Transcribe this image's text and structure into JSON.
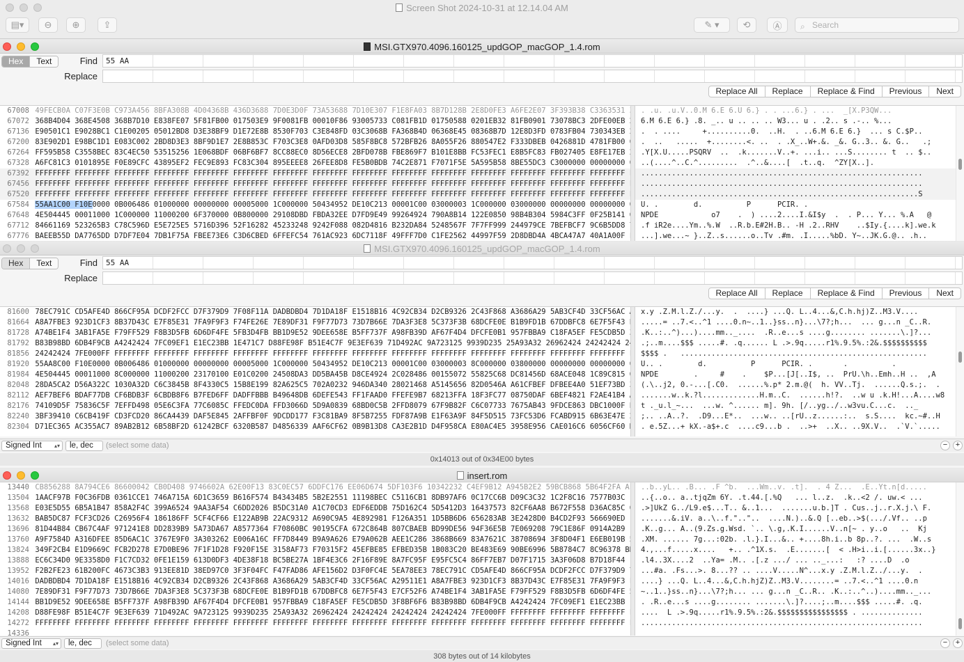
{
  "preview": {
    "title": "Screen Shot 2024-10-31 at 12.14.04 AM",
    "search_placeholder": "Search"
  },
  "win1": {
    "title": "MSI.GTX970.4096.160125_updGOP_macGOP_1.4.rom",
    "mode_hex": "Hex",
    "mode_text": "Text",
    "find_label": "Find",
    "find_value": "55 AA",
    "replace_label": "Replace",
    "buttons": [
      "Replace All",
      "Replace",
      "Replace & Find",
      "Previous",
      "Next"
    ],
    "hex_rows": [
      {
        "off": "67072",
        "hex": "368B4D04 368E4508 368B7D10 E838FE07 5F81FB00 017503E9 9F0081FB 00010F86 93005733 C081FB1D 01750588 0201EB32 81FB0901 73078BC3 2DFE00EB 258BCB81"
      },
      {
        "off": "67136",
        "hex": "E90501C1 E9028BC1 C1E00205 05012BD8 D3E38BF9 D1E72E8B 8530F703 C3E848FD 03C3068B FA368B4D 06368E45 08368B7D 12E8D3FD 0783FB04 730343EB 24508BCB"
      },
      {
        "off": "67200",
        "hex": "83E902D1 E98BC1D1 E083C002 2BD8D3E3 8BF9D1E7 2E8B853C F703C3E8 0AFD03D8 585F8BC8 572BFB26 8A055F26 880547E2 F333DBEB 0426881D 4781FB00 010F853B"
      },
      {
        "off": "67264",
        "hex": "FF595B58 C3558BEC 83C4EC50 53515256 1E068BDF 06BF6BF7 8CC88EC0 8D56ECE8 2BFD078B FBE869F7 B101E8BB FC53FEC1 E8B5FC83 FB027405 E8FE17EB 24B105E8"
      },
      {
        "off": "67328",
        "hex": "A6FC81C3 0101895E F0E89CFC 43895EF2 FEC9E893 FC83C304 895EEEE8 26FEE8D8 FE5B0BDB 74C2E871 F7071F5E 5A595B58 8BE55DC3 C3000000 00000000 00000000"
      },
      {
        "off": "67392",
        "hex": "FFFFFFFF FFFFFFFF FFFFFFFF FFFFFFFF FFFFFFFF FFFFFFFF FFFFFFFF FFFFFFFF FFFFFFFF FFFFFFFF FFFFFFFF FFFFFFFF FFFFFFFF FFFFFFFF FFFFFFFF FFFFFFFF"
      },
      {
        "off": "67456",
        "hex": "FFFFFFFF FFFFFFFF FFFFFFFF FFFFFFFF FFFFFFFF FFFFFFFF FFFFFFFF FFFFFFFF FFFFFFFF FFFFFFFF FFFFFFFF FFFFFFFF FFFFFFFF FFFFFFFF FFFFFFFF FFFFFFFF"
      },
      {
        "off": "67520",
        "hex": "FFFFFFFF FFFFFFFF FFFFFFFF FFFFFFFF FFFFFFFF FFFFFFFF FFFFFFFF FFFFFFFF FFFFFFFF FFFFFFFF FFFFFFFF FFFFFFFF FFFFFFFF FFFFFFFF FFFFFFFF FFFFFF53"
      },
      {
        "off": "67584",
        "hex_hl": "55AA1C00 F10E",
        "hex": "0000 0B006486 01000000 00000000 00005000 1C000000 50434952 DE10C213 00001C00 03000003 1C000000 03000000 00000000 00000000 00000000 00000000"
      },
      {
        "off": "67648",
        "hex": "4E504445 00011000 1C000000 11000200 6F370000 0B800000 29108DBD FBDA32EE D7FD9E49 99264924 790A8B14 122E0850 98B4B304 5984C3FF 0F25B141 00161040"
      },
      {
        "off": "67712",
        "hex": "84661169 523265B3 C78C596D E5E725E5 5716D396 52F16282 45233248 9242F088 082D4816 B232DA84 5248567F 7F7FF999 244979CE 7BEFBCF7 9C6B5DD8 7765DD6B"
      },
      {
        "off": "67776",
        "hex": "BAEEB55D DA7765DD D7DF7E04 7DB1F75A FBEE73E6 C3D6CBED 6FFEFC54 761AC923 6DC7118F 49FFF7D0 C1FE2562 44997F59 2D8DBD4A 4BCA47A7 40A1A00F F068D9D2"
      }
    ],
    "ascii_rows": [
      "6.M 6.E 6.} .8. _.. u .. .. .. W3... u . .2.. s .-.. %...",
      ".  . ....     +..........0.  ..H.  . ..6.M 6.E 6.}  ... s C.$P..",
      ".  ..   .....  +........<. ..  . .X_..W+.&. _&. G..3.. &. G..   .;",
      ".Y[X.U.....PSQRV  ..  .k.......V..+. ...i.. ...S........ t  .. $..",
      "..(....^..C.^.........  .^..&....[  .t..q.  ^ZY[X..].",
      "................................................................",
      "................................................................",
      "...............................................................S",
      "U. .        d.          P      PCIR. .",
      "NPDE            o7    .  ) ....2....I.&I$y  .  . P... Y... %.A   @",
      ".f iR2e....Ym..%.W  ..R.b.E#2H.B.. -H .2..RHV    ..$Iy.{....k].we.k",
      "...].we...~ }..Z..s......o..Tv .#m. .I.....%bD. Y~..JK.G.@.. .h.."
    ]
  },
  "win2": {
    "title": "MSI.GTX970.4096.160125_updGOP_macGOP_1.4.rom",
    "mode_hex": "Hex",
    "mode_text": "Text",
    "find_label": "Find",
    "find_value": "55 AA",
    "replace_label": "Replace",
    "buttons": [
      "Replace All",
      "Replace",
      "Replace & Find",
      "Previous",
      "Next"
    ],
    "hex_rows": [
      {
        "off": "81600",
        "hex": "78EC791C CD5AFE4D 866CF95A DCDF2FCC D7F379D9 7F08F11A DADBDBD4 7D1DA18F E1518B16 4C92CB34 D2CB9326 2C43F868 A3686A29 5AB3CF4D 33CF56AC A29511E1"
      },
      {
        "off": "81664",
        "hex": "A8A7FBE3 923D1CF3 8B37D43C E7F85E31 7FA9F9F3 F74FE26E 7E89DF31 F9F77D73 73D7B66E 7DA3F3E8 5C373F3B 68DCFE0E B1B9FD1B 67DDBFC8 6E7F5F43 E7CF52F6"
      },
      {
        "off": "81728",
        "hex": "A74BE1F4 3AB1FA5E F79FF529 F8B3D5FB 6D6DF4FE 5FB3D4FB BB1D9E52 9DEE658E B5FF737F A98FB39D AF67F4D4 DFCFE0B1 957FBBA9 C18FA5EF FE5CDB5D 3F8BF6F6"
      },
      {
        "off": "81792",
        "hex": "B83B98BD 6DB4F9CB A4242424 7FC09EF1 E1EC23BB 1E471C7 D88FE98F B51E4C7F 9E3EF639 71D492AC 9A723125 9939D235 25A93A32 26962424 24242424 24242424"
      },
      {
        "off": "81856",
        "hex": "24242424 7FE000FF FFFFFFFF FFFFFFFF FFFFFFFF FFFFFFFF FFFFFFFF FFFFFFFF FFFFFFFF FFFFFFFF FFFFFFFF FFFFFFFF FFFFFFFF FFFFFFFF FFFFFFFF FFFFFFFF"
      },
      {
        "off": "81920",
        "hex": "55AA8C00 F10E0000 0B006486 01000000 00000000 00005000 1C000000 50434952 DE10C213 00001C00 03000003 8C000000 03800000 00000000 00000000 00000000"
      },
      {
        "off": "81984",
        "hex": "4E504445 00011000 8C000000 11000200 23170100 E01C0200 24508DA3 DD5BA45B D8CE4924 2C028486 00155072 55825C68 DC81456D 68ACE048 1C89C815 0A2CCC41"
      },
      {
        "off": "82048",
        "hex": "28DA5CA2 D56A322C 1030A32D C6C3845B 8F4330C5 15B8E199 82A625C5 702A0232 946DA340 28021468 A5145656 82D0546A A61CFBEF DFBEE4A0 51EF73BD 3BDD7FFF"
      },
      {
        "off": "82112",
        "hex": "AEF7BEF6 BDAF77DB CF6BDB3F 6CBDB8F6 B7FED6FF DADFFBBB B49648DB 6DEFE543 FF1FAAD0 FFEFE9B7 68213FFA 18F3FC77 08750DAF 6BEF4821 F2AE41B4 A1FC7738"
      },
      {
        "off": "82176",
        "hex": "74109D5F 75836C5F 7EFFD498 05E6C3FA 77C6085C FFEDC0DA FFD3066D 5D9A0839 68BD0C5B 2FFD8079 67F9B82F C6C07733 7675AB43 9FDCE863 DBC1000F E32E8F5F"
      },
      {
        "off": "82240",
        "hex": "3BF39410 C6CB419F CD3FCD20 86CA4439 DAF5E845 2AFFBF0F 9DCDD177 F3C81BA9 8F5B7255 FDF87A9B E1F63A9F 84F5D515 73FC53D6 FCABD915 6B63E47E 23D7DF48"
      },
      {
        "off": "82304",
        "hex": "D71EC365 AC355AC7 89AB2B12 6B58BF2D 61242BCF 6320B587 D4856339 AAF6CF62 0B9B13D8 CA3E2B1D D4F958CA E80AC4E5 3958E956 CAE016C6 6056CF60 D6CAE096"
      }
    ],
    "ascii_rows": [
      "x.y .Z.M.l.Z./...y.  .  ....} ...Q. L..4...&,C.h.hj)Z..M3.V....",
      ".....= ..7.<..^1 ....0.n~..1..}ss..n}...\\7?;h...  ... g...n _C..R.",
      ".K..:..^)...)....mm.._....  .R..e...s ....g........ .......\\.]?...",
      ".;..m....$$$ .....#. .q...... L .>.9q.....r1%.9.5%.:2&.$$$$$$$$$$",
      "$$$$ .   ........................................................",
      "U.. .        d.          P      PCIR. .       .          .",
      "NPDE        .     #    .    $P...[J[..I$, ..  PrU.\\h..Emh..H ..  ,A",
      "(.\\..j2, 0.-...[.C0.  ......%.p* 2.m.@(  h. VV..Tj.  ......Q.s.;.  .",
      ".......w..k.?l.............H.m..C.  ......h!?.  ..w u .k.H!...A....w8",
      "t ._u.l_~...  ...w. ^...... m]. 9h. [/..yg../..w3vu.C...c.  .._",
      ";.. ..A..?.  .D9...E*..  ...w.. ..[rU..z......:..  s.S....  kc.~#..H",
      ". e.5Z...+ kX.-a$+.c  ....c9...b .  ..>+  ..X.. ..9X.V..  .`V.`....."
    ],
    "status_type": "Signed Int",
    "status_endian": "le, dec",
    "status_hint": "(select some data)",
    "footer": "0x14013 out of 0x34E00 bytes"
  },
  "win3": {
    "title": "insert.rom",
    "hex_rows": [
      {
        "off": "13504",
        "hex": "1AACF97B F0C36FDB 0361CCE1 746A715A 6D1C3659 B616F574 B43434B5 5B2E2551 11198BEC C5116CB1 8DB97AF6 0C17CC6B D09C3C32 1C2F8C16 7577B03C 149CCAC8"
      },
      {
        "off": "13568",
        "hex": "E03E5D55 6B5A1B47 858A2F4C 399A6524 9AA3AF54 C6DD2026 B5DC31A0 A1C70CD3 EDF6EDDB 75D162C4 5D5412D3 16437573 82CF6AA8 B672F558 D36AC85C 07468502"
      },
      {
        "off": "13632",
        "hex": "BAB5DC87 FCF3CD26 C26956F4 186186FF 5CF4CF66 E122AB9B 22AC9312 A690C9A5 4E892981 F126A351 1D5BB6D6 656283AB 3E2428D0 B4CD2F93 566690ED 1ADFD170"
      },
      {
        "off": "13696",
        "hex": "81D44B84 CB67C4AF 971241E8 DD2839B9 5A73DA67 A8577364 F70860BC 90195CFA 672C864B 807CBAEB BD99DE56 94F36E5B 7E069208 79C1E86F 0914A2B9 1B124B6A"
      },
      {
        "off": "13760",
        "hex": "A9F7584D A316DFEE 85D6AC1C 3767E9F0 3A303262 E006A16C FF7D8449 B9A9A626 E79A062B AEE1C286 3868B669 83A7621C 38708694 3F8D04F1 E6EB019B 5785DD73"
      },
      {
        "off": "13824",
        "hex": "349F2CB4 E1D9669C FCB2D278 E7D0BE96 7F1F1D28 F920F15E 3158AF73 F70315F2 45EFBE85 EFBED35B 1B083C20 BE483E69 90BE6996 5B8784C7 8C96378 BDDF7D07"
      },
      {
        "off": "13888",
        "hex": "EC6C34D0 9E3358D0 F1C7CD32 0FE1E159 613D0DF3 4DE38F18 BC5BE27A 1BF4E3C6 2F16F89E 8A7FC95F E95FC5C4 86FF7EB7 D07F1715 3A3F06D8 B7D18F44 1E18F16F"
      },
      {
        "off": "13952",
        "hex": "F2B2FE23 61B200FC 4673C3B3 913EE81D 38ED97C0 3F3F04FC F47FAD86 AFE156D2 D3F0FC4E 5EA78EE3 78EC791C CD5AFE4D 866CF95A DCDF2FCC D7F379D9 7F08F11A"
      },
      {
        "off": "14016",
        "hex": "DADBDBD4 7D1DA18F E1518B16 4C92CB34 D2CB9326 2C43F868 A3686A29 5AB3CF4D 33CF56AC A29511E1 A8A7FBE3 923D1CF3 8B37D43C E7F85E31 7FA9F9F3 F74FE26E"
      },
      {
        "off": "14080",
        "hex": "7E89DF31 F9F77D73 73D7B66E 7DA3F3E8 5C373F3B 68DCFE0E B1B9FD1B 67DDBFC8 6E7F5F43 E7CF52F6 A74BE1F4 3AB1FA5E F79FF529 F8B3D5FB 6D6DF4FE 5FB3D4FB"
      },
      {
        "off": "14144",
        "hex": "BB1D9E52 9DEE658E B5FF737F A98FB39D AF67F4D4 DFCFE0B1 957FBBA9 C18FA5EF FE5CDB5D 3F8BF6F6 B83B98BD 6DB4F9CB A4242424 7FC09EF1 E1EC23BB 1E471C7"
      },
      {
        "off": "14208",
        "hex": "D88FE98F B51E4C7F 9E3EF639 71D492AC 9A723125 9939D235 25A93A32 26962424 24242424 24242424 24242424 7FE000FF FFFFFFFF FFFFFFFF FFFFFFFF FFFFFFFF"
      },
      {
        "off": "14272",
        "hex": "FFFFFFFF FFFFFFFF FFFFFFFF FFFFFFFF FFFFFFFF FFFFFFFF FFFFFFFF FFFFFFFF FFFFFFFF FFFFFFFF FFFFFFFF FFFFFFFF FFFFFFFF FFFFFFFF FFFFFFFF FFFFFFFF"
      },
      {
        "off": "14336",
        "hex": ""
      }
    ],
    "ascii_rows": [
      "..{..o.. a..tjqZm 6Y. .t.44.[.%Q   ... l..z.  .k..<2 /. uw.< ...",
      ".>]UkZ G../L9.e$...T.. &..1...  .......u.b.]T . Cus..j..r.X.j.\\ F.",
      ".......&.iV. a..\\..f.\"..\"..  ....N.)..&.Q [..eb..>$(.../.Vf.. ..p",
      ".K..g... A..(9.Zs.g.Wsd. `.. \\.g,.K.I......V..n[~ . y..o   ..  Kj",
      ".XM. ...... 7g...:02b. .l.}.I...&.. +....8h.i..b 8p..?. ...  .W..s",
      "4.,...f.....x....   +.. .^1X.s.  .E.......[  < .H>i..i.[......3x..}",
      ".l4..3X....2  ..Ya= .M.. .[.z .../ ... .._...:   :? ....D  .o",
      "...#a. .Fs...>. 8...?? .. ....V.....N^...x.y .Z.M.l.Z../...y.  .",
      "....} ...Q. L..4...&,C.h.hjZ)Z..M3.V........= ..7.<..^1 ....0.n",
      "~..1..}ss..n}...\\7?;h... ... g...n _C..R.. .K..:..^..)....mm.._...",
      ". .R..e...s ....g........ .......\\.]?....;..m....$$$ .....#. .q.",
      "....  L .>.9q.....r1%.9.5%.:2&.$$$$$$$$$$$$$$$$ . ..............",
      "................................................................",
      ""
    ],
    "status_type": "Signed Int",
    "status_endian": "le, dec",
    "status_hint": "(select some data)",
    "footer": "308 bytes out of 14 kilobytes"
  }
}
